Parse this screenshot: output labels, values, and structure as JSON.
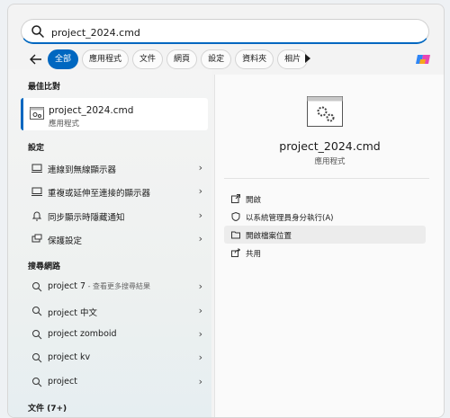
{
  "search": {
    "value": "project_2024.cmd"
  },
  "filters": [
    "全部",
    "應用程式",
    "文件",
    "網頁",
    "設定",
    "資料夾",
    "相片"
  ],
  "sections": {
    "best_match": "最佳比對",
    "settings": "設定",
    "web": "搜尋網路",
    "documents": "文件 (7+)"
  },
  "best_match": {
    "name": "project_2024.cmd",
    "type": "應用程式"
  },
  "settings_items": [
    {
      "label": "連線到無線顯示器",
      "icon": "monitor-icon"
    },
    {
      "label": "重複或延伸至連接的顯示器",
      "icon": "monitor-icon"
    },
    {
      "label": "同步顯示時隱藏通知",
      "icon": "bell-icon"
    },
    {
      "label": "保護設定",
      "icon": "screen-icon"
    }
  ],
  "web_items": [
    {
      "label": "project 7",
      "sub": " - 查看更多搜尋結果",
      "icon": "search-icon"
    },
    {
      "label": "project 中文",
      "sub": "",
      "icon": "search-icon"
    },
    {
      "label": "project zomboid",
      "sub": "",
      "icon": "search-icon"
    },
    {
      "label": "project kv",
      "sub": "",
      "icon": "search-icon"
    },
    {
      "label": "project",
      "sub": "",
      "icon": "search-icon"
    }
  ],
  "detail": {
    "name": "project_2024.cmd",
    "type": "應用程式",
    "actions": [
      {
        "label": "開啟",
        "icon": "open-icon"
      },
      {
        "label": "以系統管理員身分執行(A)",
        "icon": "shield-icon"
      },
      {
        "label": "開啟檔案位置",
        "icon": "folder-icon"
      },
      {
        "label": "共用",
        "icon": "share-icon"
      }
    ]
  },
  "colors": {
    "accent": "#0067c0"
  }
}
